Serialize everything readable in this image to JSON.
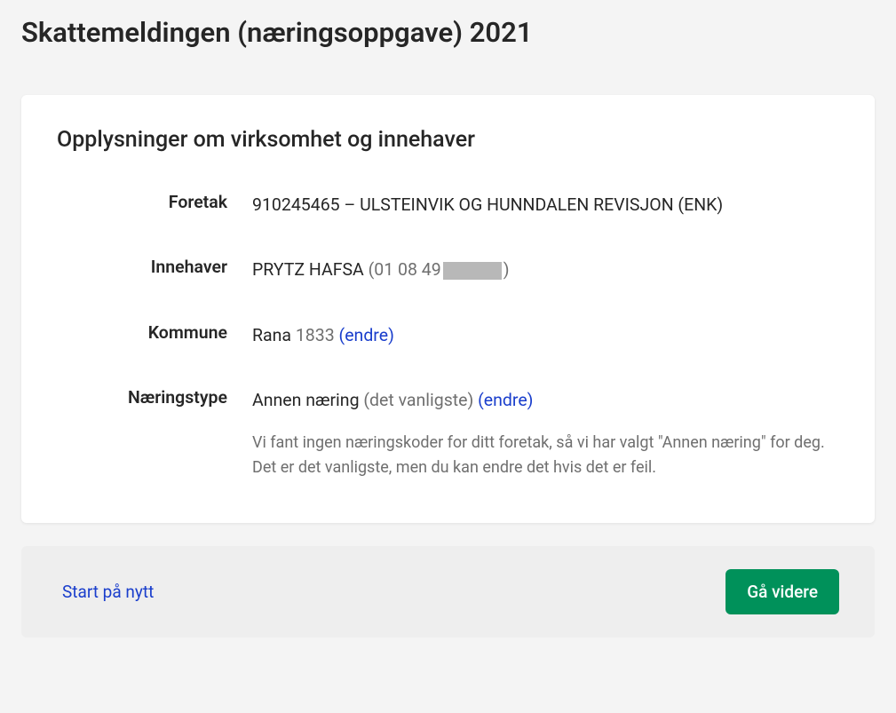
{
  "page": {
    "title": "Skattemeldingen (næringsoppgave) 2021"
  },
  "card": {
    "title": "Opplysninger om virksomhet og innehaver",
    "fields": {
      "foretak": {
        "label": "Foretak",
        "value": "910245465 – ULSTEINVIK OG HUNNDALEN REVISJON (ENK)"
      },
      "innehaver": {
        "label": "Innehaver",
        "name": "PRYTZ HAFSA",
        "idPrefix": "(01 08 49",
        "idSuffix": ")"
      },
      "kommune": {
        "label": "Kommune",
        "name": "Rana",
        "code": "1833",
        "changeLabel": "(endre)"
      },
      "naeringstype": {
        "label": "Næringstype",
        "value": "Annen næring",
        "hint": "(det vanligste)",
        "changeLabel": "(endre)",
        "note": "Vi fant ingen næringskoder for ditt foretak, så vi har valgt \"Annen næring\" for deg. Det er det vanligste, men du kan endre det hvis det er feil."
      }
    }
  },
  "actions": {
    "restart": "Start på nytt",
    "next": "Gå videre"
  }
}
